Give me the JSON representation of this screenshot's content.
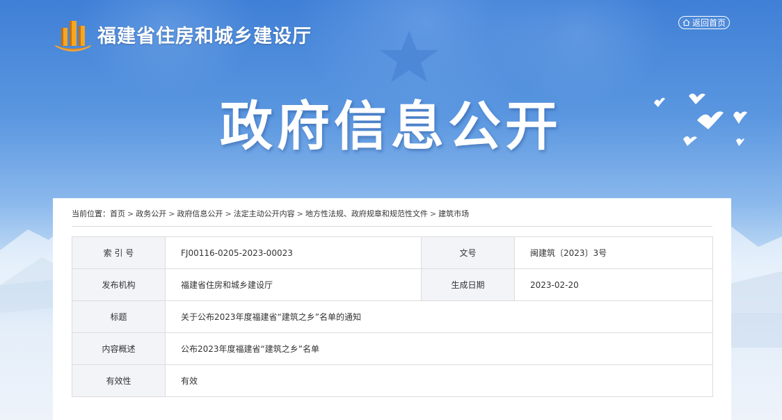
{
  "header": {
    "site_title": "福建省住房和城乡建设厅",
    "home_button_label": "返回首页",
    "banner_title": "政府信息公开"
  },
  "breadcrumb": {
    "prefix": "当前位置：",
    "items": [
      "首页",
      "政务公开",
      "政府信息公开",
      "法定主动公开内容",
      "地方性法规、政府规章和规范性文件",
      "建筑市场"
    ]
  },
  "info": {
    "index_label": "索 引 号",
    "index_value": "FJ00116-0205-2023-00023",
    "doc_no_label": "文号",
    "doc_no_value": "闽建筑〔2023〕3号",
    "publisher_label": "发布机构",
    "publisher_value": "福建省住房和城乡建设厅",
    "date_label": "生成日期",
    "date_value": "2023-02-20",
    "title_label": "标题",
    "title_value": "关于公布2023年度福建省“建筑之乡”名单的通知",
    "summary_label": "内容概述",
    "summary_value": "公布2023年度福建省“建筑之乡”名单",
    "validity_label": "有效性",
    "validity_value": "有效"
  },
  "colors": {
    "banner_blue": "#4a8ad9",
    "label_bg": "#f3f4f8",
    "border": "#dcdcdc",
    "logo_orange": "#e08a1e"
  },
  "icons": {
    "home": "home-icon",
    "logo": "building-logo-icon"
  }
}
